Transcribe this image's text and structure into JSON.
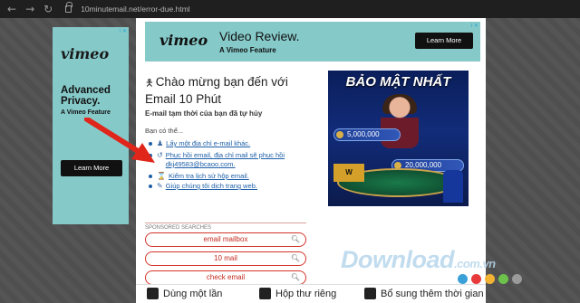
{
  "browser": {
    "back": "←",
    "forward": "→",
    "reload": "↻",
    "url": "10minutemail.net/error-due.html"
  },
  "ad_left": {
    "brand": "vimeo",
    "headline": "Advanced Privacy.",
    "sub": "A Vimeo Feature",
    "button": "Learn More",
    "adchoice": "i ✕"
  },
  "ad_top": {
    "brand": "vimeo",
    "headline": "Video Review.",
    "sub": "A Vimeo Feature",
    "button": "Learn More",
    "adchoice": "i ✕"
  },
  "main": {
    "welcome": "Chào mừng bạn đến với Email 10 Phút",
    "temp_message": "E-mail tạm thời của bạn đã tự hủy",
    "can_do": "Bạn có thể...",
    "actions": [
      {
        "icon": "user-icon",
        "glyph": "♟",
        "label": "Lấy một địa chỉ e-mail khác."
      },
      {
        "icon": "restore-icon",
        "glyph": "↺",
        "label": "Phục hồi email, địa chỉ mail sẽ phục hồi dkj49583@bcaoo.com."
      },
      {
        "icon": "history-icon",
        "glyph": "⌛",
        "label": "Kiểm tra lịch sử hộp email."
      },
      {
        "icon": "translate-icon",
        "glyph": "✎",
        "label": "Giúp chúng tôi dịch trang web."
      }
    ],
    "sponsored_label": "SPONSORED SEARCHES",
    "searches": [
      "email mailbox",
      "10 mail",
      "check email"
    ]
  },
  "promo": {
    "title": "BẢO MẬT NHẤT",
    "chip1": "5,000,000",
    "chip2": "20,000,000"
  },
  "bottom": {
    "item1": "Dùng một lần",
    "item2": "Hộp thư riêng",
    "item3": "Bổ sung thêm thời gian"
  },
  "watermark": {
    "text": "Download",
    ".suffix": ".com.vn",
    "dots": [
      "#3aa0d8",
      "#e83a3a",
      "#f2b233",
      "#6cc24a",
      "#9a9a9a"
    ]
  },
  "colors": {
    "accent": "#d4342a",
    "link": "#1d5fa8",
    "ad_bg": "#86c9c9"
  }
}
